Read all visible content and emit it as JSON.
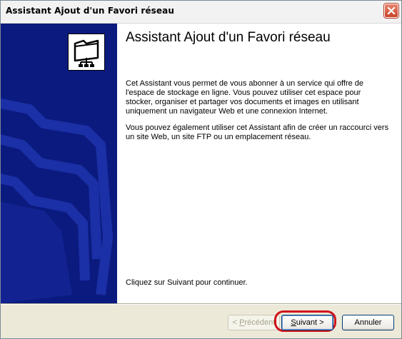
{
  "window": {
    "title": "Assistant Ajout d'un Favori réseau"
  },
  "content": {
    "heading": "Assistant Ajout d'un Favori réseau",
    "paragraph1": "Cet Assistant vous permet de vous abonner à un service qui offre de l'espace de stockage en ligne. Vous pouvez utiliser cet espace pour stocker, organiser et partager vos documents et images en utilisant uniquement un navigateur Web et une connexion Internet.",
    "paragraph2": "Vous pouvez également utiliser cet Assistant afin de créer un raccourci vers un site Web, un site FTP ou un emplacement réseau.",
    "paragraph3": "Cliquez sur Suivant pour continuer."
  },
  "buttons": {
    "prev_lead": "< ",
    "prev_key": "P",
    "prev_rest": "récédent",
    "next_key": "S",
    "next_rest": "uivant >",
    "cancel": "Annuler"
  },
  "colors": {
    "side_panel": "#0b1a7e",
    "highlight": "#d0121c"
  },
  "icons": {
    "wizard": "network-folder-icon",
    "close": "close-icon"
  }
}
